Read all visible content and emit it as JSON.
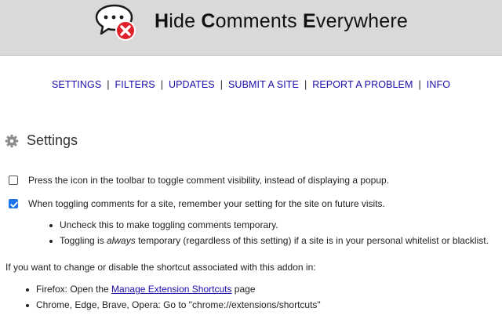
{
  "header": {
    "title_parts": [
      {
        "cap": "H",
        "rest": "ide "
      },
      {
        "cap": "C",
        "rest": "omments "
      },
      {
        "cap": "E",
        "rest": "verywhere"
      }
    ],
    "logo_icon": "speech-bubble-red-x-icon",
    "colors": {
      "bar": "#d9d9d9",
      "badge": "#e0202a"
    }
  },
  "nav": {
    "items": [
      "SETTINGS",
      "FILTERS",
      "UPDATES",
      "SUBMIT A SITE",
      "REPORT A PROBLEM",
      "INFO"
    ],
    "separator": "|",
    "link_color": "#1a0dab"
  },
  "settings": {
    "icon": "gear-icon",
    "title": "Settings",
    "options": [
      {
        "label": "Press the icon in the toolbar to toggle comment visibility, instead of displaying a popup.",
        "checked": false
      },
      {
        "label": "When toggling comments for a site, remember your setting for the site on future visits.",
        "checked": true
      }
    ],
    "notes": {
      "note1": "Uncheck this to make toggling comments temporary.",
      "note2_prefix": "Toggling is ",
      "note2_em": "always",
      "note2_suffix": " temporary (regardless of this setting) if a site is in your personal whitelist or blacklist."
    }
  },
  "shortcuts": {
    "intro": "If you want to change or disable the shortcut associated with this addon in:",
    "firefox_prefix": "Firefox: Open the ",
    "firefox_link": "Manage Extension Shortcuts",
    "firefox_suffix": " page",
    "chrome_text": "Chrome, Edge, Brave, Opera: Go to \"chrome://extensions/shortcuts\""
  }
}
